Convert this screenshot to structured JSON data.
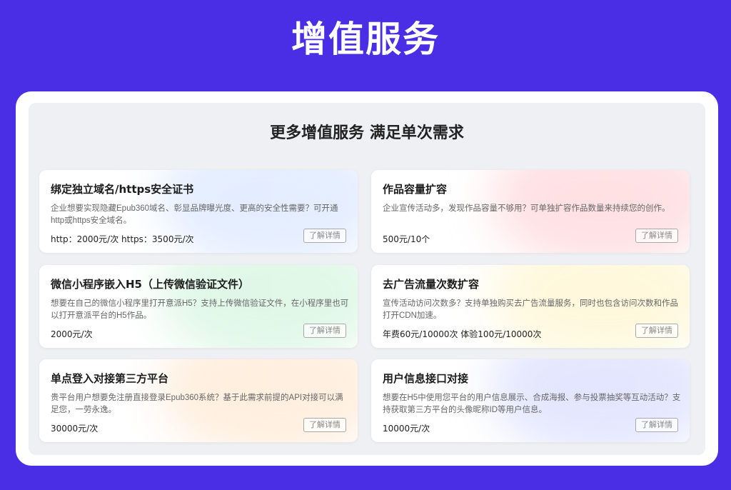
{
  "header": {
    "title": "增值服务"
  },
  "section": {
    "title": "更多增值服务 满足单次需求"
  },
  "detail_label": "了解详情",
  "cards": [
    {
      "title": "绑定独立域名/https安全证书",
      "desc": "企业想要实现隐藏Epub360域名、彰显品牌曝光度、更高的安全性需要？可开通http或https安全域名。",
      "price": "http：2000元/次 https：3500元/次",
      "glow": "#cfe0ff"
    },
    {
      "title": "作品容量扩容",
      "desc": "企业宣传活动多，发现作品容量不够用？可单独扩容作品数量来持续您的创作。",
      "price": "500元/10个",
      "glow": "#ffc9cf"
    },
    {
      "title": "微信小程序嵌入H5（上传微信验证文件）",
      "desc": "想要在自己的微信小程序里打开意派H5？支持上传微信验证文件，在小程序里也可以打开意派平台的H5作品。",
      "price": "2000元/次",
      "glow": "#c8f2d6"
    },
    {
      "title": "去广告流量次数扩容",
      "desc": "宣传活动访问次数多？支持单独购买去广告流量服务，同时也包含访问次数和作品打开CDN加速。",
      "price": "年费60元/10000次 体验100元/10000次",
      "glow": "#fff3c2"
    },
    {
      "title": "单点登入对接第三方平台",
      "desc": "贵平台用户想要免注册直接登录Epub360系统？基于此需求前提的API对接可以满足您，一劳永逸。",
      "price": "30000元/次",
      "glow": "#ffe2c6"
    },
    {
      "title": "用户信息接口对接",
      "desc": "想要在H5中使用您平台的用户信息展示、合成海报、参与投票抽奖等互动活动？支持获取第三方平台的头像昵称ID等用户信息。",
      "price": "10000元/次",
      "glow": "#cfd3ff"
    }
  ]
}
